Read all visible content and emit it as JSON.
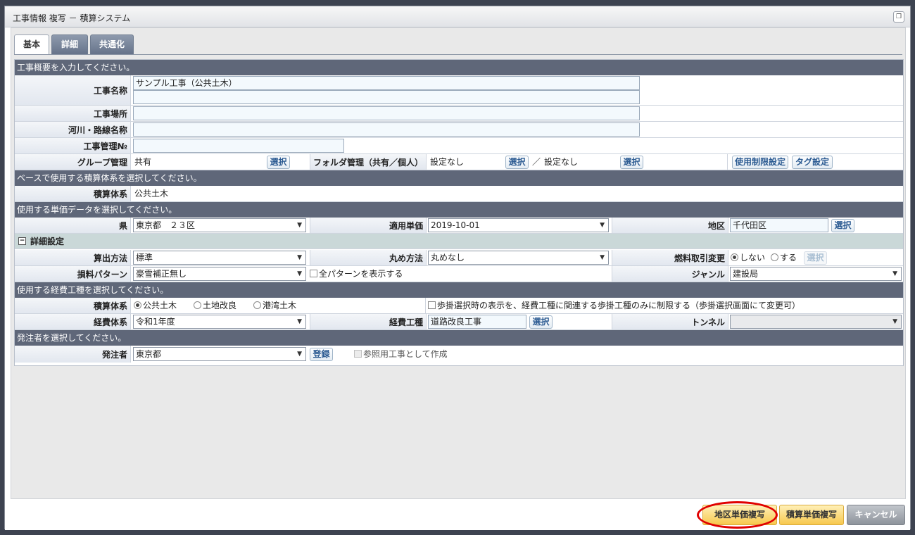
{
  "window": {
    "title": "工事情報 複写 － 積算システム"
  },
  "tabs": [
    {
      "label": "基本"
    },
    {
      "label": "詳細"
    },
    {
      "label": "共通化"
    }
  ],
  "sections": {
    "overview": "工事概要を入力してください。",
    "base_system": "ベースで使用する積算体系を選択してください。",
    "unit_price": "使用する単価データを選択してください。",
    "cost_type": "使用する経費工種を選択してください。",
    "orderer": "発注者を選択してください。"
  },
  "overview": {
    "construction_name_label": "工事名称",
    "construction_name_value": "サンプル工事（公共土木）",
    "construction_name_value2": "",
    "site_label": "工事場所",
    "site_value": "",
    "river_label": "河川・路線名称",
    "river_value": "",
    "mgmt_no_label": "工事管理№",
    "mgmt_no_value": "",
    "group_label": "グループ管理",
    "group_value": "共有",
    "select_label": "選択",
    "folder_label": "フォルダ管理（共有／個人）",
    "folder_shared_value": "設定なし",
    "folder_sep": "／",
    "folder_personal_value": "設定なし",
    "restriction_button": "使用制限設定",
    "tag_button": "タグ設定"
  },
  "base_system": {
    "label": "積算体系",
    "value": "公共土木"
  },
  "unit_price": {
    "pref_label": "県",
    "pref_value": "東京都　２３区",
    "apply_label": "適用単価",
    "apply_value": "2019-10-01",
    "area_label": "地区",
    "area_value": "千代田区",
    "select_label": "選択"
  },
  "detail": {
    "header": "詳細設定",
    "calc_label": "算出方法",
    "calc_value": "標準",
    "round_label": "丸め方法",
    "round_value": "丸めなし",
    "fuel_label": "燃料取引変更",
    "fuel_no": "しない",
    "fuel_yes": "する",
    "fuel_select": "選択",
    "loss_label": "損料パターン",
    "loss_value": "豪雪補正無し",
    "all_pattern_label": "全パターンを表示する",
    "genre_label": "ジャンル",
    "genre_value": "建設局"
  },
  "cost_type": {
    "system_label": "積算体系",
    "options": [
      "公共土木",
      "土地改良",
      "港湾土木"
    ],
    "selected_option": "公共土木",
    "restrict_label": "歩掛選択時の表示を、経費工種に関連する歩掛工種のみに制限する（歩掛選択画面にて変更可）",
    "expense_system_label": "経費体系",
    "expense_system_value": "令和1年度",
    "expense_type_label": "経費工種",
    "expense_type_value": "道路改良工事",
    "select_label": "選択",
    "tunnel_label": "トンネル",
    "tunnel_value": ""
  },
  "orderer": {
    "label": "発注者",
    "value": "東京都",
    "register_button": "登録",
    "reference_label": "参照用工事として作成"
  },
  "footer": {
    "area_copy_button": "地区単価複写",
    "estimate_copy_button": "積算単価複写",
    "cancel_button": "キャンセル"
  },
  "icons": {
    "restore": "window-restore-icon",
    "collapse": "minus-box-icon",
    "dropdown": "chevron-down-icon"
  },
  "colors": {
    "section_header": "#5f6779",
    "tab_inactive": "#7a879b",
    "highlight_circle": "#e00000",
    "primary_button": "#f7c84d"
  }
}
